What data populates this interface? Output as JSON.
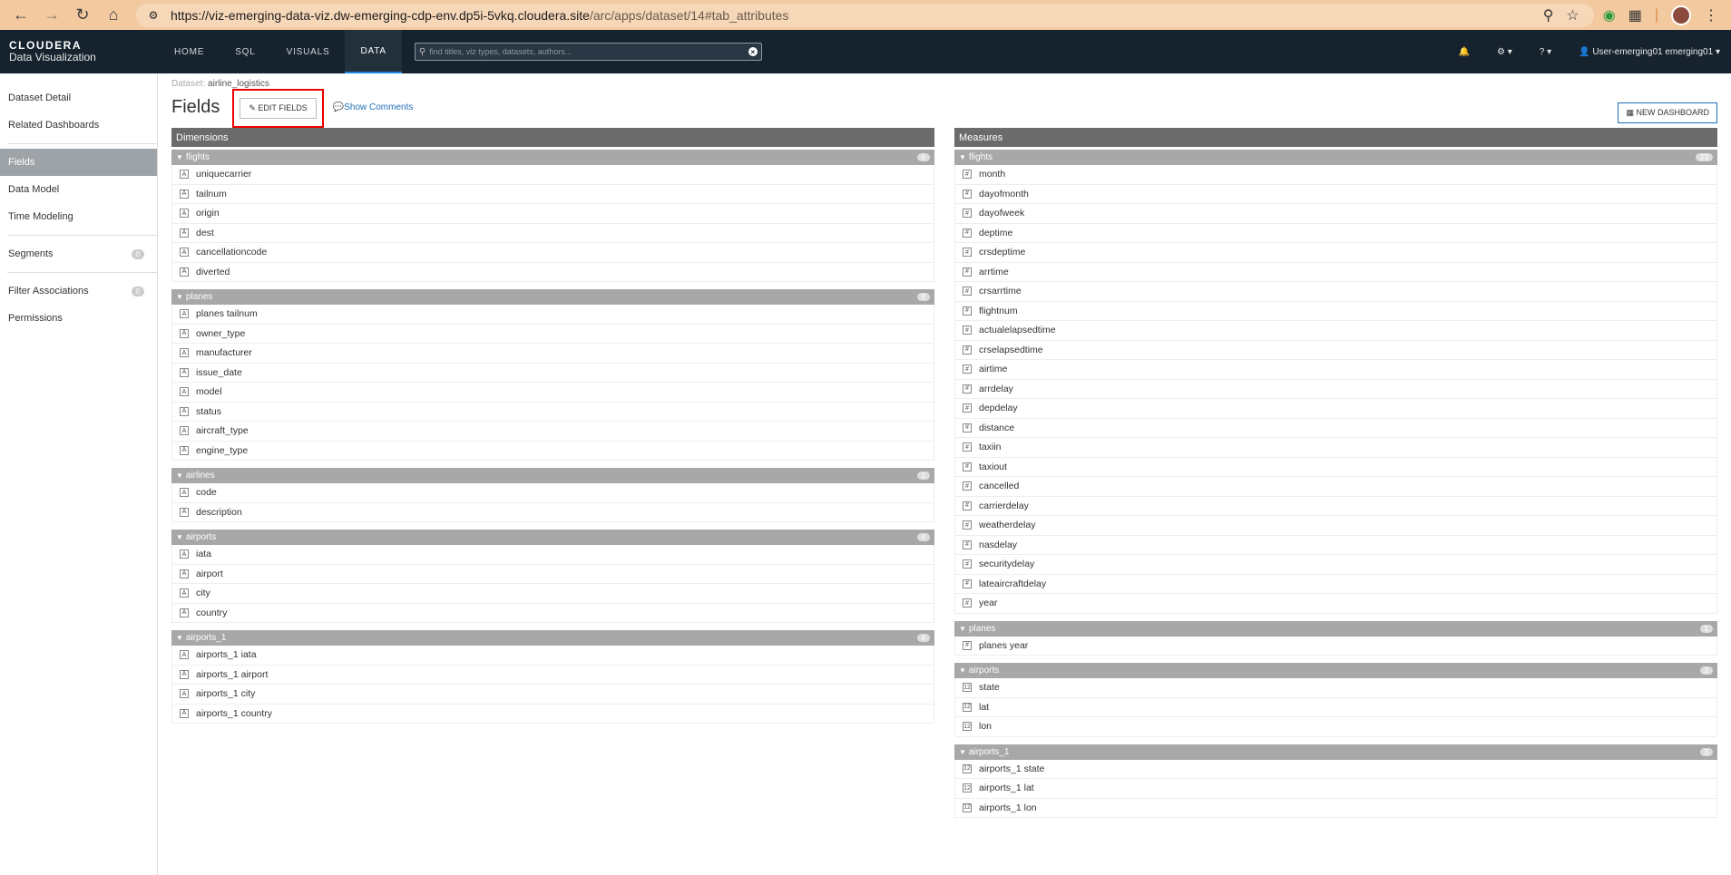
{
  "browser": {
    "url_host": "https://viz-emerging-data-viz.dw-emerging-cdp-env.dp5i-5vkq.cloudera.site",
    "url_path": "/arc/apps/dataset/14#tab_attributes"
  },
  "header": {
    "brand_line1": "CLOUDERA",
    "brand_line2": "Data Visualization",
    "tabs": [
      "HOME",
      "SQL",
      "VISUALS",
      "DATA"
    ],
    "search_placeholder": "find titles, viz types, datasets, authors...",
    "user": "User-emerging01 emerging01"
  },
  "sidebar": {
    "items": [
      {
        "label": "Dataset Detail"
      },
      {
        "label": "Related Dashboards"
      },
      {
        "label": "Fields"
      },
      {
        "label": "Data Model"
      },
      {
        "label": "Time Modeling"
      },
      {
        "label": "Segments",
        "badge": "0"
      },
      {
        "label": "Filter Associations",
        "badge": "0"
      },
      {
        "label": "Permissions"
      }
    ]
  },
  "page": {
    "crumb_label": "Dataset:",
    "crumb_value": "airline_logistics",
    "title": "Fields",
    "edit_fields": "EDIT FIELDS",
    "show_comments": "Show Comments",
    "new_dashboard": "NEW DASHBOARD"
  },
  "dimensions": {
    "title": "Dimensions",
    "groups": [
      {
        "name": "flights",
        "count": "6",
        "fields": [
          "uniquecarrier",
          "tailnum",
          "origin",
          "dest",
          "cancellationcode",
          "diverted"
        ]
      },
      {
        "name": "planes",
        "count": "8",
        "fields": [
          "planes tailnum",
          "owner_type",
          "manufacturer",
          "issue_date",
          "model",
          "status",
          "aircraft_type",
          "engine_type"
        ]
      },
      {
        "name": "airlines",
        "count": "2",
        "fields": [
          "code",
          "description"
        ]
      },
      {
        "name": "airports",
        "count": "4",
        "fields": [
          "iata",
          "airport",
          "city",
          "country"
        ]
      },
      {
        "name": "airports_1",
        "count": "4",
        "fields": [
          "airports_1 iata",
          "airports_1 airport",
          "airports_1 city",
          "airports_1 country"
        ]
      }
    ]
  },
  "measures": {
    "title": "Measures",
    "groups": [
      {
        "name": "flights",
        "count": "23",
        "type": "#",
        "fields": [
          "month",
          "dayofmonth",
          "dayofweek",
          "deptime",
          "crsdeptime",
          "arrtime",
          "crsarrtime",
          "flightnum",
          "actualelapsedtime",
          "crselapsedtime",
          "airtime",
          "arrdelay",
          "depdelay",
          "distance",
          "taxiin",
          "taxiout",
          "cancelled",
          "carrierdelay",
          "weatherdelay",
          "nasdelay",
          "securitydelay",
          "lateaircraftdelay",
          "year"
        ]
      },
      {
        "name": "planes",
        "count": "1",
        "type": "#",
        "fields": [
          "planes year"
        ]
      },
      {
        "name": "airports",
        "count": "3",
        "type": "12",
        "fields": [
          "state",
          "lat",
          "lon"
        ]
      },
      {
        "name": "airports_1",
        "count": "3",
        "type": "12",
        "fields": [
          "airports_1 state",
          "airports_1 lat",
          "airports_1 lon"
        ]
      }
    ]
  }
}
